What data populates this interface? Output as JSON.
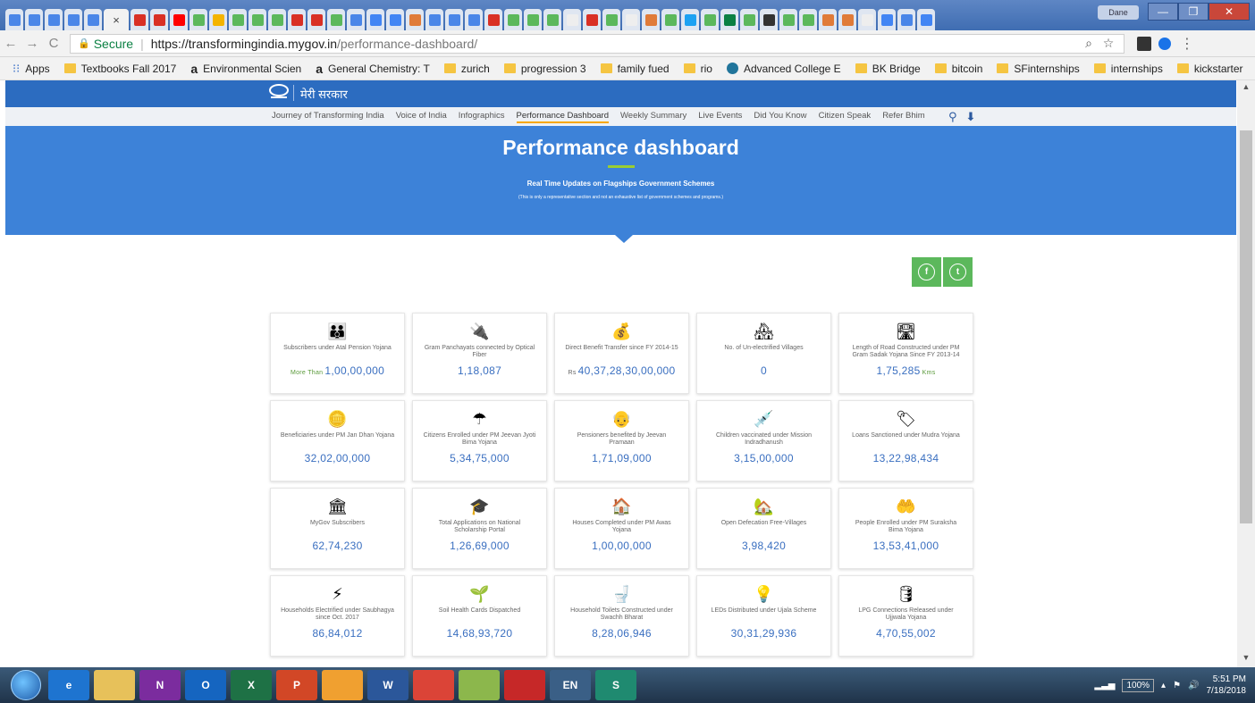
{
  "browser": {
    "tabs": [
      {
        "icon": "translate-icon",
        "color": "#4a86e8"
      },
      {
        "icon": "docs-icon",
        "color": "#4a86e8"
      },
      {
        "icon": "docs-icon",
        "color": "#4a86e8"
      },
      {
        "icon": "sheets-icon",
        "color": "#4a86e8"
      },
      {
        "icon": "docs-icon",
        "color": "#4a86e8"
      },
      {
        "icon": "gmail-icon",
        "color": "#d93025"
      },
      {
        "icon": "gmail-icon",
        "color": "#d93025"
      },
      {
        "icon": "youtube-icon",
        "color": "#ff0000"
      },
      {
        "icon": "mygov-icon",
        "color": "#5cb85c"
      },
      {
        "icon": "drive-icon",
        "color": "#f4b400"
      },
      {
        "icon": "mygov-icon",
        "color": "#5cb85c"
      },
      {
        "icon": "mygov-icon",
        "color": "#5cb85c"
      },
      {
        "icon": "mygov-icon",
        "color": "#5cb85c"
      },
      {
        "icon": "calendar-icon",
        "color": "#d93025"
      },
      {
        "icon": "diamond-icon",
        "color": "#d93025"
      },
      {
        "icon": "mygov-icon",
        "color": "#5cb85c"
      },
      {
        "icon": "docs-icon",
        "color": "#4a86e8"
      },
      {
        "icon": "google-icon",
        "color": "#4285f4"
      },
      {
        "icon": "google-icon",
        "color": "#4285f4"
      },
      {
        "icon": "e-icon",
        "color": "#e07b39"
      },
      {
        "icon": "e-icon",
        "color": "#4a86e8"
      },
      {
        "icon": "e-icon",
        "color": "#4a86e8"
      },
      {
        "icon": "mail-icon",
        "color": "#4a86e8"
      },
      {
        "icon": "diamond-icon",
        "color": "#d93025"
      },
      {
        "icon": "mygov-icon",
        "color": "#5cb85c"
      },
      {
        "icon": "mygov-icon",
        "color": "#5cb85c"
      },
      {
        "icon": "mygov-icon",
        "color": "#5cb85c"
      },
      {
        "icon": "page-icon",
        "color": "#eeeeee"
      },
      {
        "icon": "leaf-icon",
        "color": "#d93025"
      },
      {
        "icon": "mygov-icon",
        "color": "#5cb85c"
      },
      {
        "icon": "page-icon",
        "color": "#eeeeee"
      },
      {
        "icon": "e-icon",
        "color": "#e07b39"
      },
      {
        "icon": "mygov-icon",
        "color": "#5cb85c"
      },
      {
        "icon": "twitter-icon",
        "color": "#1da1f2"
      },
      {
        "icon": "mygov-icon",
        "color": "#5cb85c"
      },
      {
        "icon": "square-icon",
        "color": "#0b8043"
      },
      {
        "icon": "mygov-icon",
        "color": "#5cb85c"
      },
      {
        "icon": "github-icon",
        "color": "#333333"
      },
      {
        "icon": "mygov-icon",
        "color": "#5cb85c"
      },
      {
        "icon": "mygov-icon",
        "color": "#5cb85c"
      },
      {
        "icon": "e-icon",
        "color": "#e07b39"
      },
      {
        "icon": "e-icon",
        "color": "#e07b39"
      },
      {
        "icon": "page-icon",
        "color": "#eeeeee"
      },
      {
        "icon": "google-icon",
        "color": "#4285f4"
      },
      {
        "icon": "e-icon",
        "color": "#4a86e8"
      },
      {
        "icon": "google-icon",
        "color": "#4285f4"
      }
    ],
    "profile_name": "Dane",
    "secure_label": "Secure",
    "url_host": "https://transformingindia.mygov.in",
    "url_path": "/performance-dashboard/"
  },
  "bookmarks": [
    {
      "label": "Apps",
      "type": "apps"
    },
    {
      "label": "Textbooks Fall 2017",
      "type": "folder"
    },
    {
      "label": "Environmental Scien",
      "type": "amazon"
    },
    {
      "label": "General Chemistry: T",
      "type": "amazon"
    },
    {
      "label": "zurich",
      "type": "folder"
    },
    {
      "label": "progression 3",
      "type": "folder"
    },
    {
      "label": "family fued",
      "type": "folder"
    },
    {
      "label": "rio",
      "type": "folder"
    },
    {
      "label": "Advanced College E",
      "type": "wordpress"
    },
    {
      "label": "BK Bridge",
      "type": "folder"
    },
    {
      "label": "bitcoin",
      "type": "folder"
    },
    {
      "label": "SFinternships",
      "type": "folder"
    },
    {
      "label": "internships",
      "type": "folder"
    },
    {
      "label": "kickstarter",
      "type": "folder"
    }
  ],
  "site": {
    "logo_text": "मेरी सरकार",
    "nav": [
      "Journey of Transforming India",
      "Voice of India",
      "Infographics",
      "Performance Dashboard",
      "Weekly Summary",
      "Live Events",
      "Did You Know",
      "Citizen Speak",
      "Refer Bhim"
    ],
    "active_nav": "Performance Dashboard",
    "hero_title": "Performance dashboard",
    "hero_sub": "Real Time Updates on Flagships Government Schemes",
    "hero_note": "(This is only a representative section and not an exhaustive list of government schemes and programs.)"
  },
  "cards": [
    {
      "icon": "pension-icon",
      "glyph": "👪",
      "label": "Subscribers under Atal Pension Yojana",
      "prefix": "More Than",
      "value": "1,00,00,000"
    },
    {
      "icon": "fiber-cable-icon",
      "glyph": "🔌",
      "label": "Gram Panchayats connected by Optical Fiber",
      "value": "1,18,087"
    },
    {
      "icon": "benefit-transfer-icon",
      "glyph": "💰",
      "label": "Direct Benefit Transfer since FY 2014-15",
      "prefix_rs": "Rs",
      "value": "40,37,28,30,00,000"
    },
    {
      "icon": "village-icon",
      "glyph": "🏘",
      "label": "No. of Un-electrified Villages",
      "value": "0"
    },
    {
      "icon": "road-icon",
      "glyph": "🛣",
      "label": "Length of Road Constructed under PM Gram Sadak Yojana Since FY 2013-14",
      "value": "1,75,285",
      "suffix": "Kms"
    },
    {
      "icon": "coins-icon",
      "glyph": "🪙",
      "label": "Beneficiaries under PM Jan Dhan Yojana",
      "value": "32,02,00,000"
    },
    {
      "icon": "umbrella-family-icon",
      "glyph": "☂",
      "label": "Citizens Enrolled under PM Jeevan Jyoti Bima Yojana",
      "value": "5,34,75,000"
    },
    {
      "icon": "pensioner-icon",
      "glyph": "👴",
      "label": "Pensioners benefited by Jeevan Pramaan",
      "value": "1,71,09,000"
    },
    {
      "icon": "vaccine-icon",
      "glyph": "💉",
      "label": "Children vaccinated under Mission Indradhanush",
      "value": "3,15,00,000"
    },
    {
      "icon": "mudra-icon",
      "glyph": "🏷",
      "label": "Loans Sanctioned under Mudra Yojana",
      "value": "13,22,98,434"
    },
    {
      "icon": "mygov-logo-icon",
      "glyph": "🏛",
      "label": "MyGov Subscribers",
      "value": "62,74,230"
    },
    {
      "icon": "scholarship-icon",
      "glyph": "🎓",
      "label": "Total Applications on National Scholarship Portal",
      "value": "1,26,69,000"
    },
    {
      "icon": "house-icon",
      "glyph": "🏠",
      "label": "Houses Completed under PM Awas Yojana",
      "value": "1,00,00,000"
    },
    {
      "icon": "sanitation-village-icon",
      "glyph": "🏡",
      "label": "Open Defecation Free-Villages",
      "value": "3,98,420"
    },
    {
      "icon": "hands-family-icon",
      "glyph": "🤲",
      "label": "People Enrolled under PM Suraksha Bima Yojana",
      "value": "13,53,41,000"
    },
    {
      "icon": "electric-pole-icon",
      "glyph": "⚡",
      "label": "Households Electrified under Saubhagya since Oct. 2017",
      "value": "86,84,012"
    },
    {
      "icon": "soil-hands-icon",
      "glyph": "🌱",
      "label": "Soil Health Cards Dispatched",
      "value": "14,68,93,720"
    },
    {
      "icon": "toilet-icon",
      "glyph": "🚽",
      "label": "Household Toilets Constructed under Swachh Bharat",
      "value": "8,28,06,946"
    },
    {
      "icon": "led-bulb-icon",
      "glyph": "💡",
      "label": "LEDs Distributed under Ujala Scheme",
      "value": "30,31,29,936"
    },
    {
      "icon": "lpg-cylinder-icon",
      "glyph": "🛢",
      "label": "LPG Connections Released under Ujjwala Yojana",
      "value": "4,70,55,002"
    }
  ],
  "taskbar": {
    "apps": [
      {
        "name": "ie-icon",
        "label": "e",
        "color": "#1e74d0"
      },
      {
        "name": "explorer-icon",
        "label": "",
        "color": "#e7c15a"
      },
      {
        "name": "onenote-icon",
        "label": "N",
        "color": "#7b2c9e"
      },
      {
        "name": "outlook-icon",
        "label": "O",
        "color": "#1565c0"
      },
      {
        "name": "excel-icon",
        "label": "X",
        "color": "#1e7145"
      },
      {
        "name": "powerpoint-icon",
        "label": "P",
        "color": "#d24726"
      },
      {
        "name": "media-icon",
        "label": "",
        "color": "#f0a030"
      },
      {
        "name": "word-icon",
        "label": "W",
        "color": "#2b579a"
      },
      {
        "name": "chrome-icon",
        "label": "",
        "color": "#db4437"
      },
      {
        "name": "folder-app-icon",
        "label": "",
        "color": "#8cb74c"
      },
      {
        "name": "red-app-icon",
        "label": "",
        "color": "#c62828"
      },
      {
        "name": "language-icon",
        "label": "EN",
        "color": "#3a5f86"
      },
      {
        "name": "sway-icon",
        "label": "S",
        "color": "#1f8a70"
      }
    ],
    "zoom": "100%",
    "time": "5:51 PM",
    "date": "7/18/2018"
  }
}
